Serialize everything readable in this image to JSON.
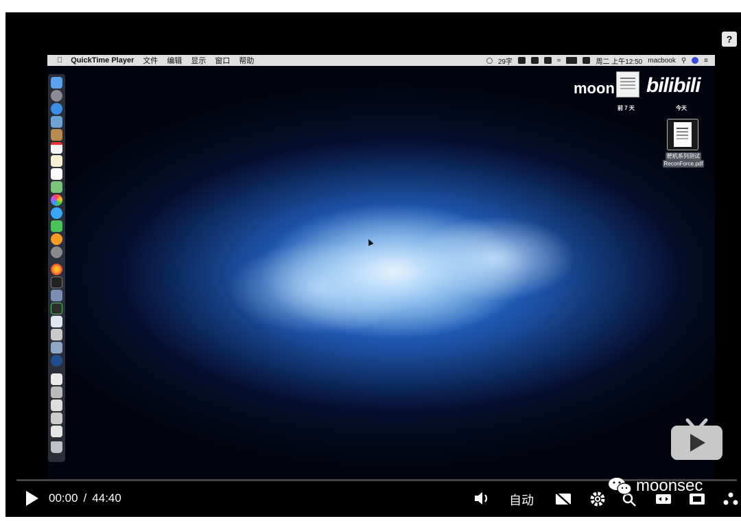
{
  "menubar": {
    "app_name": "QuickTime Player",
    "menus": [
      "文件",
      "编辑",
      "显示",
      "窗口",
      "帮助"
    ],
    "status": {
      "chars": "29字",
      "datetime": "周二 上午12:50",
      "user": "macbook"
    }
  },
  "desktop": {
    "brand_text": "moon",
    "brand_logo_text": "bilibili",
    "label_left": "前 7 天",
    "label_right": "今天",
    "file_name_line1": "靶机系列测试",
    "file_name_line2": "ReconForce.pdf"
  },
  "player": {
    "help_label": "?",
    "current_time": "00:00",
    "separator": "/",
    "duration": "44:40",
    "quality_label": "自动",
    "progress": 0,
    "watermark": "moonsec"
  },
  "icons": {
    "help": "question-icon",
    "play": "play-icon",
    "volume": "speaker-icon",
    "subtitle": "subtitle-off-icon",
    "settings": "gear-icon",
    "picture_in_picture": "pip-icon",
    "widescreen": "widescreen-icon",
    "fullscreen": "fullscreen-icon"
  },
  "colors": {
    "background": "#000000",
    "progress_track": "#444444",
    "progress_fill": "#e0e0e0"
  }
}
